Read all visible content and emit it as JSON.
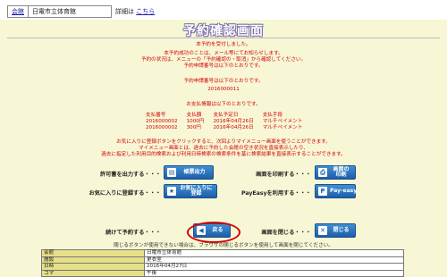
{
  "header": {
    "link1": "会館",
    "facility": "日電市立体育館",
    "detail_label": "詳細は",
    "detail_link": "こちら"
  },
  "page_title": "予約確認画面",
  "messages": {
    "l1": "本予約を受付しました。",
    "l2": "本予約成功のことは、メール等にてお知らせします。",
    "l3": "予約の状況は、メニューの「予約確認の・取消」から確認してください。",
    "l4": "予約申請番号は以下のとおりです。",
    "l5": "予約申請番号は以下のとおりです。",
    "app_no": "2016000011",
    "l6": "お支払情報は以下のとおりです。"
  },
  "payment": {
    "headers": [
      "支払番号",
      "支払額",
      "支払予定日",
      "支払手段"
    ],
    "rows": [
      [
        "2016000002",
        "1000円",
        "2016年04月26日",
        "マルチペイメント"
      ],
      [
        "2016000002",
        "300円",
        "2016年04月26日",
        "マルチペイメント"
      ]
    ]
  },
  "hint": {
    "l1": "お気に入りに登録ボタンをクリックすると、次回よりマイメニュー画面を使うことができます。",
    "l2": "マイメニュー画面とは、過去に予約した会館の空き状況を直接表示したり、",
    "l3": "過去に指定した利用目的検索および利用日時検索の検索条件を基に検索結果を直接表示することができます。"
  },
  "actions": {
    "row1_left_label": "許可書を出力する・・・",
    "permit_btn": "帳票出力",
    "row1_right_label": "画面を印刷する・・・",
    "print_btn": "画面の\n印刷",
    "row2_left_label": "お気に入りに登録する・・・",
    "fav_btn": "お気に入りに\n登録",
    "row2_right_label": "PayEasyを利用する・・・",
    "payeasy_btn": "Pay-easy",
    "row3_left_label": "続けて予約する・・・",
    "back_btn": "戻る",
    "row3_right_label": "画面を閉じる・・・",
    "close_btn": "閉じる"
  },
  "note": "閉じるボタンが使用できない場合は、ブラウザの閉じるボタンを使用して画面を閉じてください。",
  "info": [
    {
      "key": "会館",
      "value": "日電市立体育館"
    },
    {
      "key": "施設",
      "value": "更衣室"
    },
    {
      "key": "日時",
      "value": "2016年04月27日"
    },
    {
      "key": "コマ",
      "value": "午後"
    }
  ],
  "colors": {
    "accent": "#d40000",
    "button": "#1d5ea8",
    "background": "#f7f7d6"
  }
}
